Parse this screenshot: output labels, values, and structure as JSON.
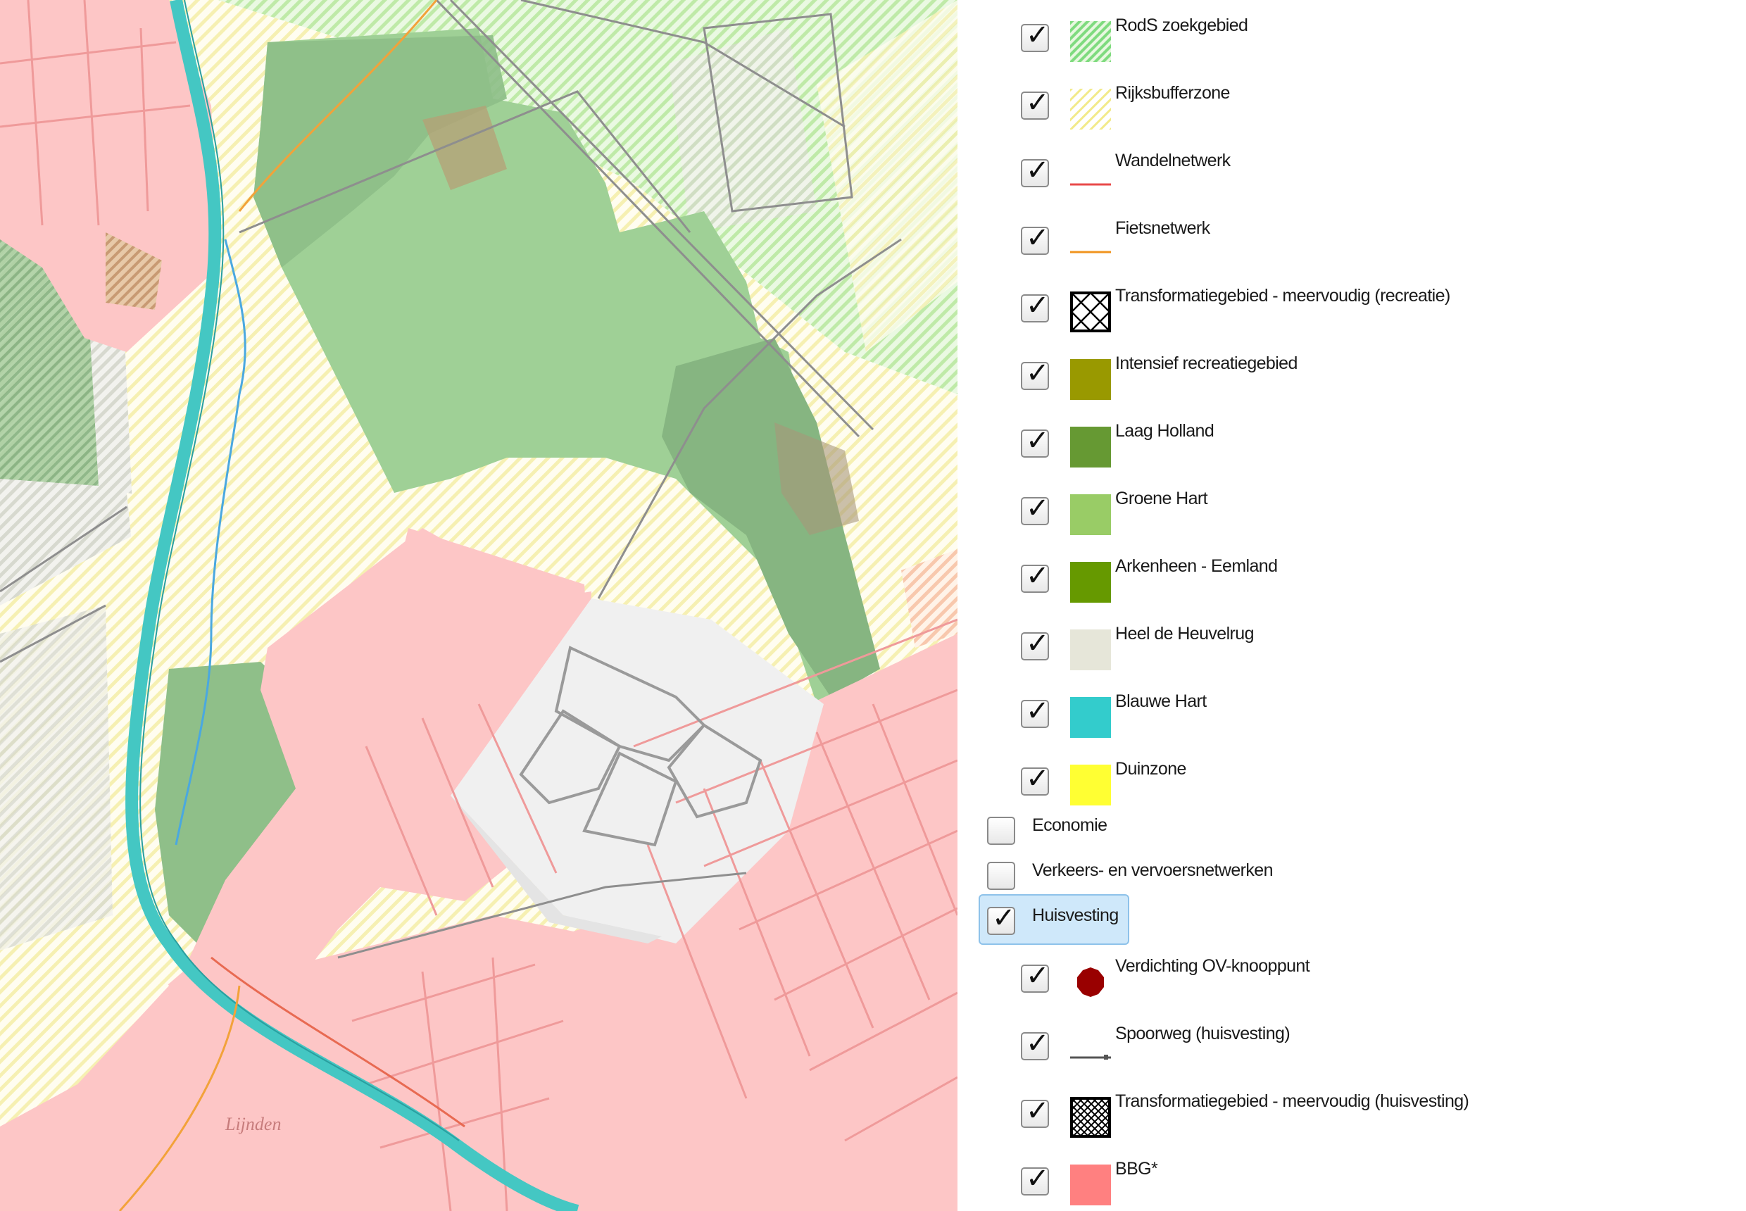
{
  "map": {
    "place_label": "Lijnden"
  },
  "legend": {
    "sub_items_a": [
      {
        "label": "RodS zoekgebied",
        "checked": true,
        "symbol": "green-hatch"
      },
      {
        "label": "Rijksbufferzone",
        "checked": true,
        "symbol": "yellow-hatch"
      },
      {
        "label": "Wandelnetwerk",
        "checked": true,
        "symbol": "red-line"
      },
      {
        "label": "Fietsnetwerk",
        "checked": true,
        "symbol": "orange-line"
      },
      {
        "label": "Transformatiegebied - meervoudig (recreatie)",
        "checked": true,
        "symbol": "cross-hatch-box"
      },
      {
        "label": "Intensief recreatiegebied",
        "checked": true,
        "symbol": "fill",
        "color": "#999900"
      },
      {
        "label": "Laag Holland",
        "checked": true,
        "symbol": "fill",
        "color": "#669933"
      },
      {
        "label": "Groene Hart",
        "checked": true,
        "symbol": "fill",
        "color": "#99cc66"
      },
      {
        "label": "Arkenheen - Eemland",
        "checked": true,
        "symbol": "fill",
        "color": "#669900"
      },
      {
        "label": "Heel de Heuvelrug",
        "checked": true,
        "symbol": "fill",
        "color": "#e6e6d9"
      },
      {
        "label": "Blauwe Hart",
        "checked": true,
        "symbol": "fill",
        "color": "#33cccc"
      },
      {
        "label": "Duinzone",
        "checked": true,
        "symbol": "fill",
        "color": "#ffff33"
      }
    ],
    "groups": [
      {
        "label": "Economie",
        "checked": false
      },
      {
        "label": "Verkeers- en vervoersnetwerken",
        "checked": false
      },
      {
        "label": "Huisvesting",
        "checked": true,
        "selected": true
      }
    ],
    "sub_items_b": [
      {
        "label": "Verdichting OV-knooppunt",
        "checked": true,
        "symbol": "red-dot",
        "color": "#990000"
      },
      {
        "label": "Spoorweg (huisvesting)",
        "checked": true,
        "symbol": "rail-line"
      },
      {
        "label": "Transformatiegebied - meervoudig (huisvesting)",
        "checked": true,
        "symbol": "dense-cross-hatch-box"
      },
      {
        "label": "BBG*",
        "checked": true,
        "symbol": "fill",
        "color": "#ff8080"
      }
    ],
    "checkmark": "✓"
  },
  "colors": {
    "urban_pink": "#fdc7c7",
    "pink_lines": "#f09a9a",
    "green_hart": "#9fd096",
    "dark_green": "#86b581",
    "light_green_hatch": "#c8f0b4",
    "yellow_hatch": "#fbf7c8",
    "blue_hart": "#44c7c3",
    "heuvelrug": "#e9e9e4"
  }
}
